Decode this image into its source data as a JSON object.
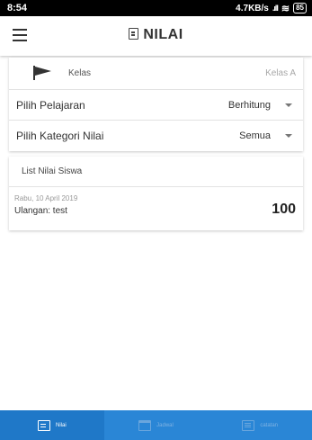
{
  "status_bar": {
    "time": "8:54",
    "network": "4.7KB/s",
    "signal": ".ıll",
    "wifi": "≋",
    "battery": "85"
  },
  "app_bar": {
    "title": "NILAI",
    "title_icon": "clipboard-icon",
    "menu_icon": "hamburger-menu-icon"
  },
  "filters": {
    "kelas": {
      "icon": "flag-icon",
      "label": "Kelas",
      "value": "Kelas A"
    },
    "pelajaran": {
      "label": "Pilih Pelajaran",
      "value": "Berhitung"
    },
    "kategori": {
      "label": "Pilih Kategori Nilai",
      "value": "Semua"
    }
  },
  "list": {
    "title": "List Nilai Siswa",
    "items": [
      {
        "date": "Rabu, 10 April 2019",
        "label": "Ulangan: test",
        "score": "100"
      }
    ]
  },
  "bottom_nav": {
    "active": "Nilai",
    "items": [
      {
        "label": "Nilai",
        "icon": "clipboard-icon"
      },
      {
        "label": "Jadwal",
        "icon": "calendar-icon"
      },
      {
        "label": "catatan",
        "icon": "notes-icon"
      }
    ]
  },
  "colors": {
    "nav_background": "#2a86d6",
    "nav_active": "#1f78c8"
  }
}
